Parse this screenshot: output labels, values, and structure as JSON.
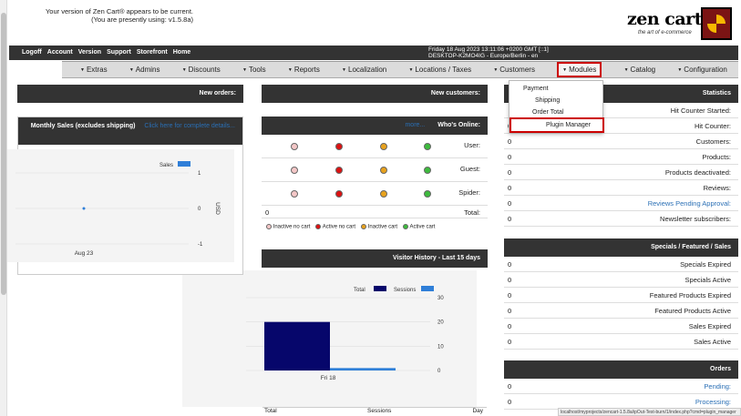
{
  "logo": {
    "text": "zen cart",
    "tagline": "the art of e-commerce"
  },
  "version_notice": {
    "line1": "Your version of Zen Cart® appears to be current.",
    "line2": "(You are presently using: v1.5.8a)"
  },
  "topbar": {
    "links": [
      "Home",
      "Storefront",
      "Support",
      "Version",
      "Account",
      "Logoff"
    ],
    "datetime": "Friday 18 Aug 2023 13:11:06 +0200 GMT [::1]",
    "host": "DESKTOP-K2MO4IG - Europe/Berlin - en"
  },
  "menu": [
    "Configuration",
    "Catalog",
    "Modules",
    "Customers",
    "Locations / Taxes",
    "Localization",
    "Reports",
    "Tools",
    "Discounts",
    "Admins",
    "Extras"
  ],
  "dropdown": [
    "Payment",
    "Shipping",
    "Order Total",
    "Plugin Manager"
  ],
  "statistics": {
    "title": "Statistics",
    "rows": [
      {
        "label": "Hit Counter Started:",
        "value": ""
      },
      {
        "label": "Hit Counter:",
        "value": "0"
      },
      {
        "label": "Customers:",
        "value": "0"
      },
      {
        "label": "Products:",
        "value": "0"
      },
      {
        "label": "Products deactivated:",
        "value": "0"
      },
      {
        "label": "Reviews:",
        "value": "0"
      },
      {
        "label": "Reviews Pending Approval:",
        "value": "0"
      },
      {
        "label": "Newsletter subscribers:",
        "value": "0"
      }
    ]
  },
  "specials": {
    "title": "Specials / Featured / Sales",
    "rows": [
      {
        "label": "Specials Expired",
        "value": "0"
      },
      {
        "label": "Specials Active",
        "value": "0"
      },
      {
        "label": "Featured Products Expired",
        "value": "0"
      },
      {
        "label": "Featured Products Active",
        "value": "0"
      },
      {
        "label": "Sales Expired",
        "value": "0"
      },
      {
        "label": "Sales Active",
        "value": "0"
      }
    ]
  },
  "orders": {
    "title": "Orders",
    "rows": [
      {
        "label": "Pending:",
        "value": "0"
      },
      {
        "label": "Processing:",
        "value": "0"
      }
    ]
  },
  "new_customers": {
    "title": "New customers:"
  },
  "whos_online": {
    "title": "Who's Online:",
    "more": "more...",
    "rows": [
      {
        "label": "User:"
      },
      {
        "label": "Guest:"
      },
      {
        "label": "Spider:"
      },
      {
        "label": "Total:",
        "value": "0"
      }
    ],
    "legend": [
      "Active cart",
      "Inactive cart",
      "Active no cart",
      "Inactive no cart"
    ],
    "colors": {
      "active_cart": "#3dbb3d",
      "inactive_cart": "#e8a21d",
      "active_no_cart": "#d11",
      "inactive_no_cart": "#f4c7c7"
    }
  },
  "visitor_history": {
    "title": "Visitor History - Last 15 days",
    "footer": {
      "day": "Day",
      "sessions": "Sessions",
      "total": "Total"
    }
  },
  "new_orders": {
    "title": "New orders:"
  },
  "monthly_sales": {
    "title": "Monthly Sales (excludes shipping)",
    "link": "Click here for complete details..."
  },
  "statusbar": "localhost/myprojects/zencart-1.5.8a/ipOut-Test-burn/1/index.php?cmd=plugin_manager",
  "chart_data": [
    {
      "type": "bar",
      "categories": [
        "Fri 18"
      ],
      "series": [
        {
          "name": "Sessions",
          "values": [
            1
          ]
        },
        {
          "name": "Total",
          "values": [
            20
          ]
        }
      ],
      "ylim": [
        0,
        30
      ],
      "yticks": [
        0,
        10,
        20,
        30
      ],
      "colors": {
        "Sessions": "#2f7fd8",
        "Total": "#06066b"
      }
    },
    {
      "type": "line",
      "categories": [
        "Aug 23"
      ],
      "series": [
        {
          "name": "Sales",
          "values": [
            0
          ]
        }
      ],
      "ylim": [
        -1,
        1
      ],
      "yticks": [
        -1,
        0,
        1
      ],
      "ylabel": "USD",
      "colors": {
        "Sales": "#2f7fd8"
      }
    }
  ]
}
